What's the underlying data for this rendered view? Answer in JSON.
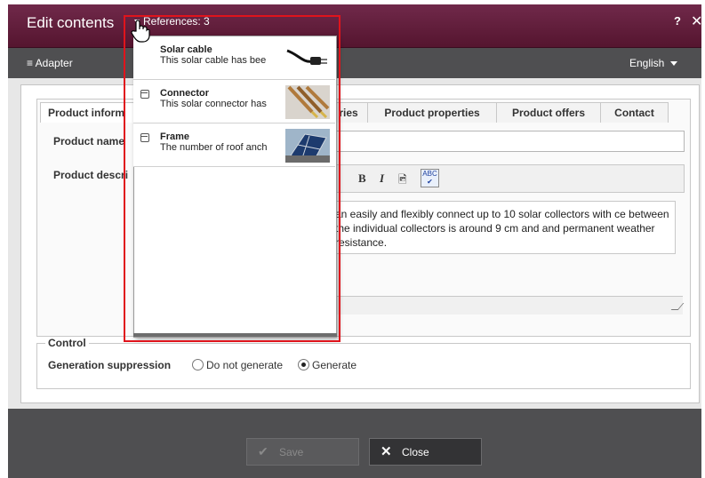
{
  "window": {
    "title": "Edit contents",
    "references_label": "References: 3",
    "help_label": "?",
    "close_label": "✕"
  },
  "toolbar": {
    "adapter_label": "≡ Adapter",
    "language": "English"
  },
  "tabs": [
    {
      "label": "Product inform"
    },
    {
      "label": "ries"
    },
    {
      "label": "Product properties"
    },
    {
      "label": "Product offers"
    },
    {
      "label": "Contact"
    }
  ],
  "form": {
    "product_name_label": "Product name",
    "product_description_label": "Product descri",
    "description_text": "an easily and flexibly connect up to 10 solar collectors with ce between the individual collectors is around 9 cm and and permanent weather resistance.",
    "editor_buttons": {
      "bold": "B",
      "italic": "I",
      "image": "🖻",
      "spellcheck": "ABC ✔"
    }
  },
  "control": {
    "legend": "Control",
    "generation_label": "Generation suppression",
    "options": [
      {
        "label": "Do not generate",
        "selected": false
      },
      {
        "label": "Generate",
        "selected": true
      }
    ]
  },
  "footer": {
    "save_label": "Save",
    "close_label": "Close"
  },
  "references": [
    {
      "name": "Solar cable",
      "desc": "This solar cable has bee",
      "thumb": "cable"
    },
    {
      "name": "Connector",
      "desc": "This solar connector has",
      "thumb": "connector"
    },
    {
      "name": "Frame",
      "desc": "The number of roof anch",
      "thumb": "panel"
    }
  ],
  "colors": {
    "titlebar": "#5f1c3a",
    "toolbar": "#4f4f51",
    "highlight": "#e0141c"
  }
}
